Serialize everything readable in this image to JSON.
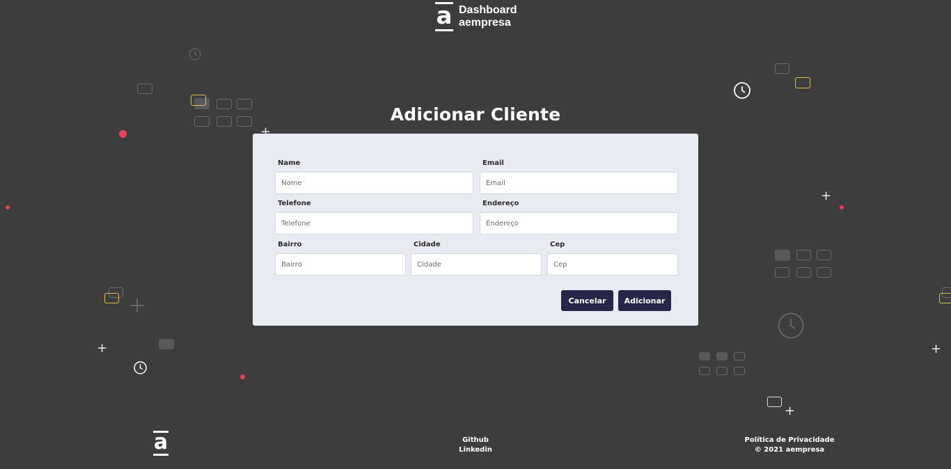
{
  "header": {
    "brand_line1": "Dashboard",
    "brand_line2": "aempresa",
    "logo_glyph": "a"
  },
  "page": {
    "title": "Adicionar Cliente"
  },
  "form": {
    "name": {
      "label": "Name",
      "placeholder": "Nome"
    },
    "email": {
      "label": "Email",
      "placeholder": "Email"
    },
    "phone": {
      "label": "Telefone",
      "placeholder": "Telefone"
    },
    "address": {
      "label": "Endereço",
      "placeholder": "Endereço"
    },
    "district": {
      "label": "Bairro",
      "placeholder": "Bairro"
    },
    "city": {
      "label": "Cidade",
      "placeholder": "Cidade"
    },
    "zip": {
      "label": "Cep",
      "placeholder": "Cep"
    },
    "cancel_label": "Cancelar",
    "submit_label": "Adicionar"
  },
  "footer": {
    "logo_glyph": "a",
    "links": [
      "Github",
      "Linkedin"
    ],
    "privacy": "Política de Privacidade",
    "copyright": "© 2021 aempresa"
  },
  "colors": {
    "background": "#3d3d3d",
    "card": "#e9ebf3",
    "button": "#262649",
    "accent_red": "#e2445c",
    "accent_yellow": "#e0c04a"
  }
}
